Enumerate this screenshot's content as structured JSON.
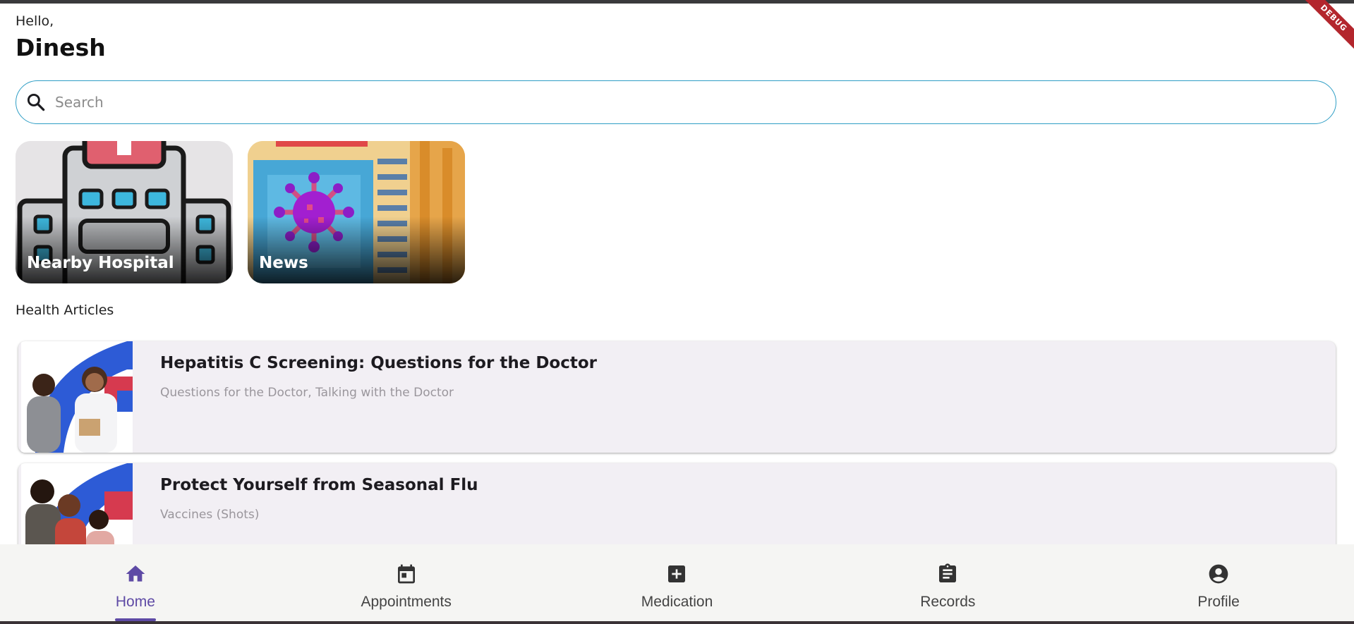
{
  "header": {
    "greeting": "Hello,",
    "user_name": "Dinesh"
  },
  "search": {
    "placeholder": "Search"
  },
  "tiles": [
    {
      "label": "Nearby Hospital"
    },
    {
      "label": "News"
    }
  ],
  "articles": {
    "section_title": "Health Articles",
    "items": [
      {
        "title": "Hepatitis C Screening: Questions for the Doctor",
        "subtitle": "Questions for the Doctor, Talking with the Doctor"
      },
      {
        "title": "Protect Yourself from Seasonal Flu",
        "subtitle": "Vaccines (Shots)"
      }
    ]
  },
  "nav": {
    "items": [
      {
        "label": "Home",
        "icon": "home-icon",
        "active": true
      },
      {
        "label": "Appointments",
        "icon": "calendar-icon",
        "active": false
      },
      {
        "label": "Medication",
        "icon": "medical-plus-icon",
        "active": false
      },
      {
        "label": "Records",
        "icon": "clipboard-icon",
        "active": false
      },
      {
        "label": "Profile",
        "icon": "account-circle-icon",
        "active": false
      }
    ]
  },
  "debug_banner": "DEBUG",
  "colors": {
    "accent": "#5e4aa5",
    "search_border": "#2f9ec5",
    "card_background": "#f2eff4",
    "nav_background": "#f5f5f3"
  }
}
